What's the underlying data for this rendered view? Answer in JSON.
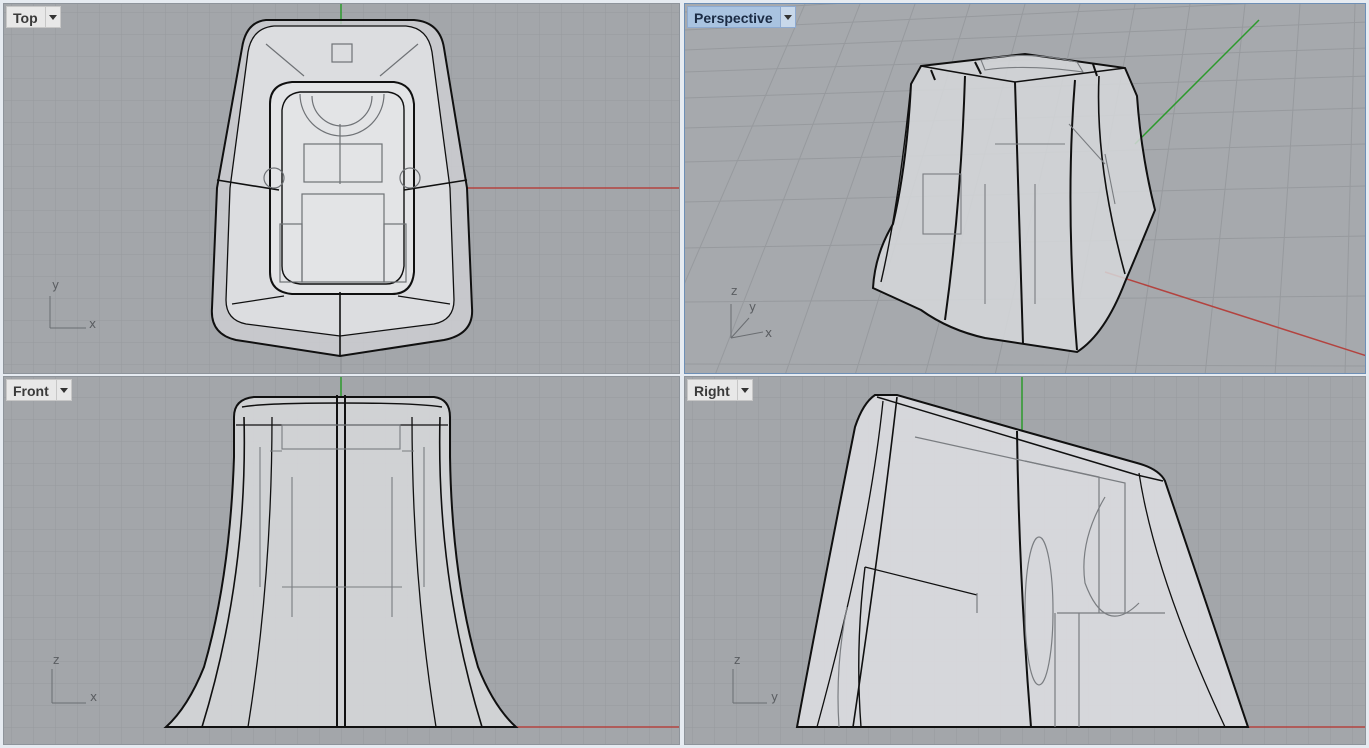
{
  "viewports": {
    "top": {
      "label": "Top",
      "axes": [
        "x",
        "y"
      ]
    },
    "perspective": {
      "label": "Perspective",
      "axes": [
        "x",
        "y",
        "z"
      ]
    },
    "front": {
      "label": "Front",
      "axes": [
        "x",
        "z"
      ]
    },
    "right": {
      "label": "Right",
      "axes": [
        "y",
        "z"
      ]
    }
  },
  "colors": {
    "viewport_bg": "#a3a6aa",
    "grid_minor": "#979a9e",
    "grid_major": "#8b8e92",
    "x_axis": "#b3433f",
    "y_axis": "#2c9a2c",
    "active_tab": "#a9c3e0",
    "edge": "#101010",
    "surface": "#dcdcdc"
  },
  "icons": {
    "dropdown": "triangle-down-icon"
  }
}
